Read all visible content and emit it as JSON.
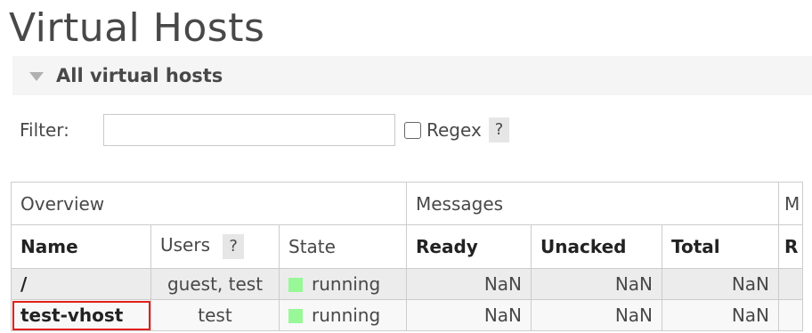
{
  "page": {
    "title": "Virtual Hosts"
  },
  "section": {
    "label": "All virtual hosts"
  },
  "filter": {
    "label": "Filter:",
    "value": "",
    "regex_label": "Regex",
    "regex_checked": false,
    "help": "?"
  },
  "table": {
    "groups": {
      "overview": "Overview",
      "messages": "Messages",
      "next_cut": "M"
    },
    "headers": {
      "name": "Name",
      "users": "Users",
      "users_help": "?",
      "state": "State",
      "ready": "Ready",
      "unacked": "Unacked",
      "total": "Total",
      "next_cut": "R"
    },
    "rows": [
      {
        "name": "/",
        "users": "guest, test",
        "state": "running",
        "ready": "NaN",
        "unacked": "NaN",
        "total": "NaN"
      },
      {
        "name": "test-vhost",
        "users": "test",
        "state": "running",
        "ready": "NaN",
        "unacked": "NaN",
        "total": "NaN",
        "highlighted": true
      }
    ]
  },
  "colors": {
    "running": "#98f898",
    "highlight": "#e0201c",
    "row_bg": "#ececec"
  }
}
